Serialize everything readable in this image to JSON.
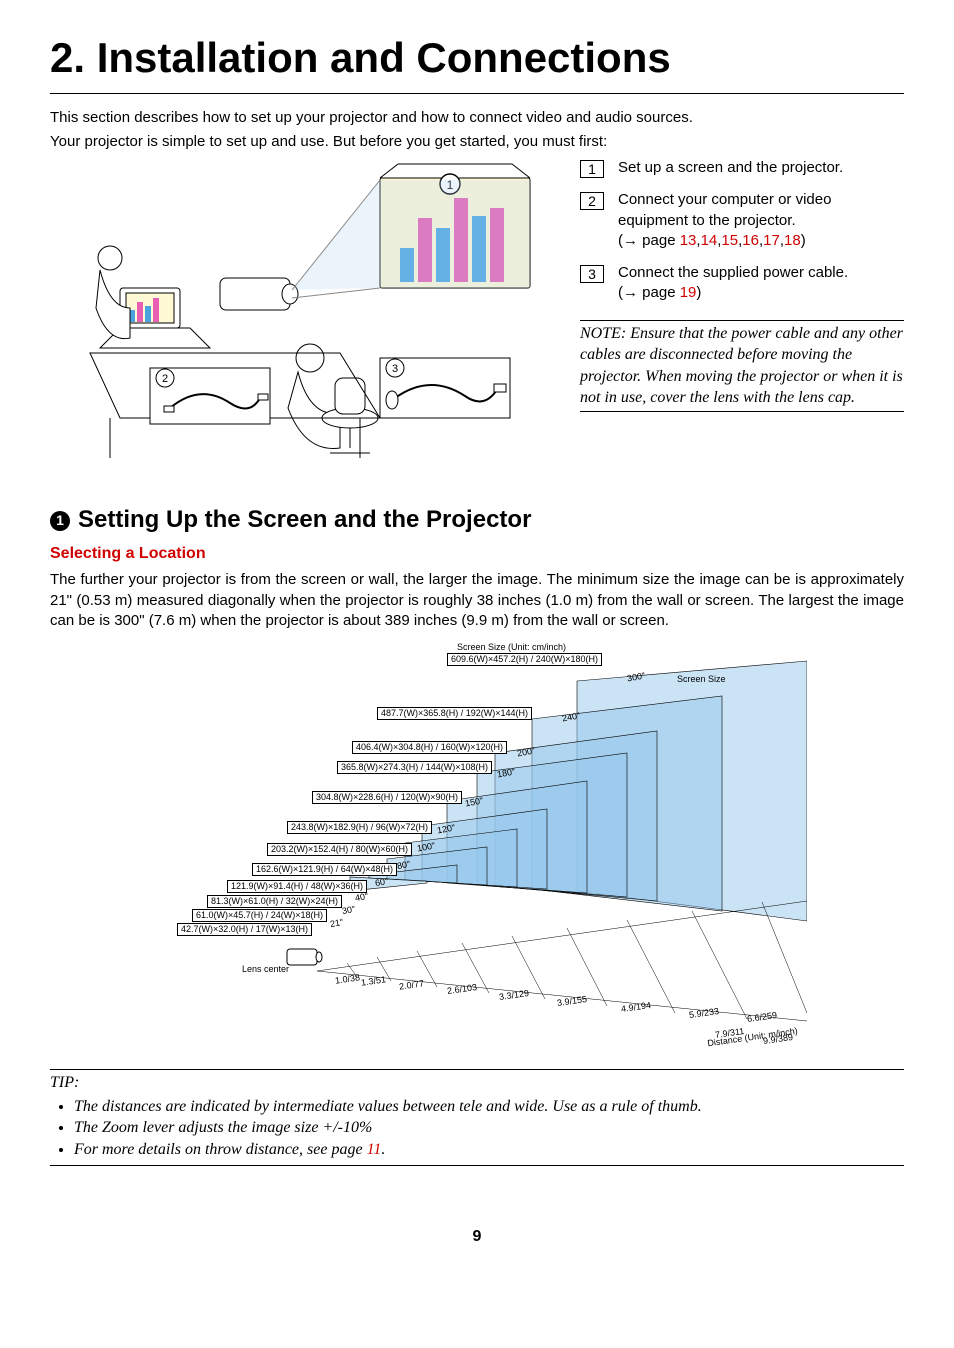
{
  "chapter_title": "2. Installation and Connections",
  "intro_line1": "This section describes how to set up your projector and how to connect video and audio sources.",
  "intro_line2": "Your projector is simple to set up and use. But before you get started, you must first:",
  "steps": [
    {
      "num": "1",
      "text": "Set up a screen and the projector."
    },
    {
      "num": "2",
      "text": "Connect your computer or video equipment to the projector.",
      "ref_prefix": "(→ page ",
      "pages": [
        "13",
        "14",
        "15",
        "16",
        "17",
        "18"
      ],
      "ref_suffix": ")"
    },
    {
      "num": "3",
      "text": "Connect the supplied power cable.",
      "ref_prefix": "(→ page ",
      "pages": [
        "19"
      ],
      "ref_suffix": ")"
    }
  ],
  "note": "NOTE: Ensure that the power cable and any other cables are disconnected before moving the projector. When moving the projector or when it is not in use, cover the lens with the lens cap.",
  "section_num": "1",
  "section_title": "Setting Up the Screen and the Projector",
  "subheading": "Selecting a Location",
  "body": "The further your projector is from the screen or wall, the larger the image. The minimum size the image can be is approximately 21\" (0.53 m) measured diagonally when the projector is roughly 38 inches (1.0 m) from the wall or screen. The largest the image can be is 300\" (7.6 m) when the projector is about 389 inches (9.9 m) from the wall or screen.",
  "chart_data": {
    "type": "table",
    "title": "Screen Size (Unit: cm/inch)",
    "axis_label": "Distance (Unit: m/inch)",
    "screen_size_label": "Screen Size",
    "lens_center_label": "Lens center",
    "rows": [
      {
        "diag_inch": 300,
        "cm_w": 609.6,
        "cm_h": 457.2,
        "in_w": 240,
        "in_h": 180
      },
      {
        "diag_inch": 240,
        "cm_w": 487.7,
        "cm_h": 365.8,
        "in_w": 192,
        "in_h": 144
      },
      {
        "diag_inch": 200,
        "cm_w": 406.4,
        "cm_h": 304.8,
        "in_w": 160,
        "in_h": 120
      },
      {
        "diag_inch": 180,
        "cm_w": 365.8,
        "cm_h": 274.3,
        "in_w": 144,
        "in_h": 108
      },
      {
        "diag_inch": 150,
        "cm_w": 304.8,
        "cm_h": 228.6,
        "in_w": 120,
        "in_h": 90
      },
      {
        "diag_inch": 120,
        "cm_w": 243.8,
        "cm_h": 182.9,
        "in_w": 96,
        "in_h": 72
      },
      {
        "diag_inch": 100,
        "cm_w": 203.2,
        "cm_h": 152.4,
        "in_w": 80,
        "in_h": 60
      },
      {
        "diag_inch": 80,
        "cm_w": 162.6,
        "cm_h": 121.9,
        "in_w": 64,
        "in_h": 48
      },
      {
        "diag_inch": 60,
        "cm_w": 121.9,
        "cm_h": 91.4,
        "in_w": 48,
        "in_h": 36
      },
      {
        "diag_inch": 40,
        "cm_w": 81.3,
        "cm_h": 61.0,
        "in_w": 32,
        "in_h": 24
      },
      {
        "diag_inch": 30,
        "cm_w": 61.0,
        "cm_h": 45.7,
        "in_w": 24,
        "in_h": 18
      },
      {
        "diag_inch": 21,
        "cm_w": 42.7,
        "cm_h": 32.0,
        "in_w": 17,
        "in_h": 13
      }
    ],
    "distances": [
      {
        "m": 1.0,
        "inch": 38
      },
      {
        "m": 1.3,
        "inch": 51
      },
      {
        "m": 2.0,
        "inch": 77
      },
      {
        "m": 2.6,
        "inch": 103
      },
      {
        "m": 3.3,
        "inch": 129
      },
      {
        "m": 3.9,
        "inch": 155
      },
      {
        "m": 4.9,
        "inch": 194
      },
      {
        "m": 5.9,
        "inch": 233
      },
      {
        "m": 6.6,
        "inch": 259
      },
      {
        "m": 7.9,
        "inch": 311
      },
      {
        "m": 9.9,
        "inch": 389
      }
    ]
  },
  "tip_label": "TIP:",
  "tips": [
    "The distances are indicated by intermediate values between tele and wide. Use as a rule of thumb.",
    "The Zoom lever adjusts the image size +/-10%",
    "For more details on throw distance, see page "
  ],
  "tip_page": "11",
  "page_number": "9"
}
